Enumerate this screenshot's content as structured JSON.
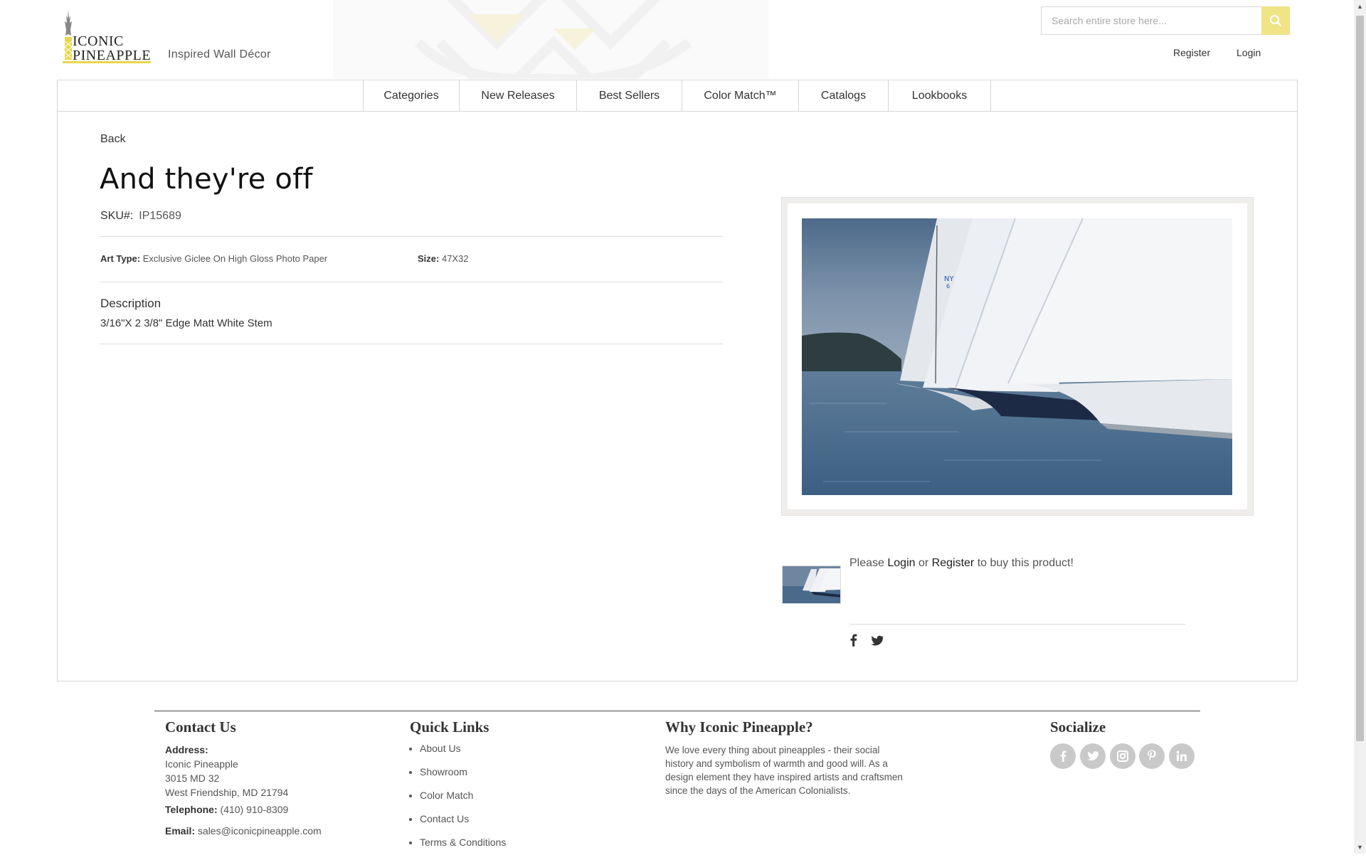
{
  "header": {
    "brand": {
      "line1": "ICONIC",
      "line2": "PINEAPPLE"
    },
    "tagline": "Inspired Wall Décor",
    "search": {
      "placeholder": "Search entire store here...",
      "value": "",
      "button_icon": "search-icon"
    },
    "register": "Register",
    "login": "Login"
  },
  "nav": {
    "items": [
      "Categories",
      "New Releases",
      "Best Sellers",
      "Color Match™",
      "Catalogs",
      "Lookbooks"
    ]
  },
  "product": {
    "back": "Back",
    "title": "And they're off",
    "sku_label": "SKU#:",
    "sku": "IP15689",
    "art_type_label": "Art Type:",
    "art_type": "Exclusive Giclee On High Gloss Photo Paper",
    "size_label": "Size:",
    "size": "47X32",
    "description_heading": "Description",
    "description": "3/16\"X 2 3/8\" Edge Matt White Stem",
    "sail_marking": {
      "line1": "NY",
      "line2": "6"
    },
    "buy_prefix": "Please",
    "buy_login": "Login",
    "buy_or": "or",
    "buy_register": "Register",
    "buy_suffix": "to buy this product!",
    "share_icons": [
      "facebook-icon",
      "twitter-icon"
    ]
  },
  "footer": {
    "contact": {
      "heading": "Contact Us",
      "address_label": "Address:",
      "address_lines": [
        "Iconic Pineapple",
        "3015 MD 32",
        "West Friendship, MD 21794"
      ],
      "telephone_label": "Telephone:",
      "telephone": "(410) 910-8309",
      "email_label": "Email:",
      "email": "sales@iconicpineapple.com"
    },
    "quick_links": {
      "heading": "Quick Links",
      "items": [
        "About Us",
        "Showroom",
        "Color Match",
        "Contact Us",
        "Terms & Conditions"
      ]
    },
    "why": {
      "heading": "Why Iconic Pineapple?",
      "text": "We love every thing about pineapples - their social history and symbolism of warmth and good will. As a design element they have inspired artists and craftsmen since the days of the American Colonialists."
    },
    "socialize": {
      "heading": "Socialize",
      "icons": [
        "facebook-icon",
        "twitter-icon",
        "instagram-icon",
        "pinterest-icon",
        "linkedin-icon"
      ]
    }
  },
  "colors": {
    "accent": "#f0e487",
    "logo_bar": "#e8d64a",
    "text": "#333333",
    "border": "#d6d6d6"
  }
}
